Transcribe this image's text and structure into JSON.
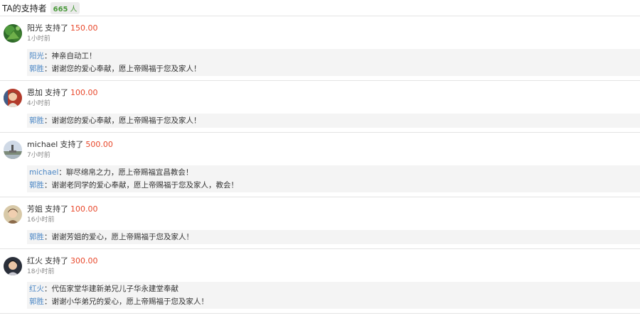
{
  "header": {
    "title": "TA的支持者",
    "count": "665",
    "unit": "人"
  },
  "supporters": [
    {
      "name": "阳光",
      "action": "支持了",
      "amount": "150.00",
      "time": "1小时前",
      "avatar": "leaf-green-avatar",
      "replies": [
        {
          "name": "阳光",
          "text": "：神亲自动工！"
        },
        {
          "name": "郭胜",
          "text": "：谢谢您的爱心奉献，愿上帝赐福于您及家人！"
        }
      ]
    },
    {
      "name": "恩加",
      "action": "支持了",
      "amount": "100.00",
      "time": "4小时前",
      "avatar": "portrait-avatar",
      "replies": [
        {
          "name": "郭胜",
          "text": "：谢谢您的爱心奉献，愿上帝赐福于您及家人！"
        }
      ]
    },
    {
      "name": "michael",
      "action": "支持了",
      "amount": "500.00",
      "time": "7小时前",
      "avatar": "landscape-avatar",
      "replies": [
        {
          "name": "michael",
          "text": "：聊尽绵帛之力，愿上帝赐福宜昌教会！"
        },
        {
          "name": "郭胜",
          "text": "：谢谢老同学的爱心奉献，愿上帝赐福于您及家人，教会！"
        }
      ]
    },
    {
      "name": "芳姐",
      "action": "支持了",
      "amount": "100.00",
      "time": "16小时前",
      "avatar": "portrait-avatar",
      "replies": [
        {
          "name": "郭胜",
          "text": "：谢谢芳姐的爱心，愿上帝赐福于您及家人！"
        }
      ]
    },
    {
      "name": "红火",
      "action": "支持了",
      "amount": "300.00",
      "time": "18小时前",
      "avatar": "portrait-avatar",
      "replies": [
        {
          "name": "红火",
          "text": "：代伍家堂华建新弟兄儿子华永建堂奉献"
        },
        {
          "name": "郭胜",
          "text": "：谢谢小华弟兄的爱心，愿上帝赐福于您及家人！"
        }
      ]
    }
  ]
}
